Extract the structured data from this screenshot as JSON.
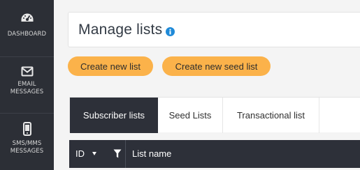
{
  "sidebar": {
    "items": [
      {
        "label": "DASHBOARD",
        "icon": "gauge-icon"
      },
      {
        "label": "EMAIL MESSAGES",
        "icon": "envelope-icon"
      },
      {
        "label": "SMS/MMS MESSAGES",
        "icon": "mobile-phone-icon"
      }
    ]
  },
  "header": {
    "title": "Manage lists",
    "info_icon": "info-icon"
  },
  "actions": {
    "create_list": "Create new list",
    "create_seed_list": "Create new seed list"
  },
  "tabs": [
    {
      "label": "Subscriber lists",
      "active": true
    },
    {
      "label": "Seed Lists",
      "active": false
    },
    {
      "label": "Transactional list",
      "active": false
    }
  ],
  "table": {
    "columns": [
      "ID",
      "List name"
    ]
  },
  "colors": {
    "sidebar_bg": "#2c2f36",
    "accent_button": "#fbb24a",
    "info_blue": "#1f8ad8",
    "dark_header": "#2d3039"
  }
}
